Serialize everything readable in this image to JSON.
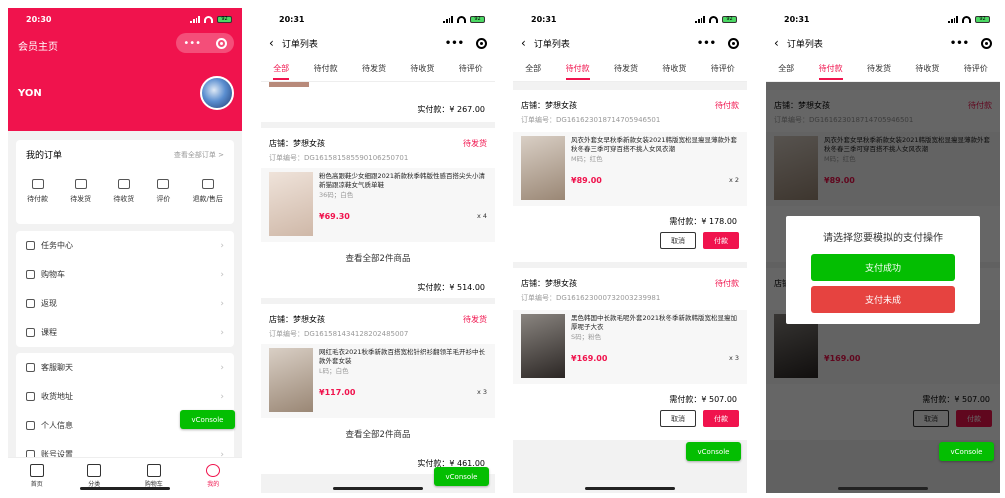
{
  "status": {
    "time1": "20:30",
    "time2": "20:31",
    "battery": "92"
  },
  "member": {
    "title": "会员主页",
    "capsule_dots": "•••",
    "username": "YON",
    "orders_title": "我的订单",
    "orders_more": "查看全部订单 >",
    "order_icons": [
      {
        "label": "待付款",
        "icon": "wallet-icon"
      },
      {
        "label": "待发货",
        "icon": "box-icon"
      },
      {
        "label": "待收货",
        "icon": "truck-icon"
      },
      {
        "label": "评价",
        "icon": "comment-icon"
      },
      {
        "label": "退款/售后",
        "icon": "refund-icon"
      }
    ],
    "menu1": [
      "任务中心",
      "购物车",
      "返现",
      "课程"
    ],
    "menu2": [
      "客服聊天",
      "收货地址",
      "个人信息",
      "账号设置"
    ],
    "tabbar": [
      "首页",
      "分类",
      "购物车",
      "我的"
    ],
    "vconsole": "vConsole"
  },
  "orders": {
    "nav_title": "订单列表",
    "back": "‹",
    "tabs": [
      "全部",
      "待付款",
      "待发货",
      "待收货",
      "待评价"
    ],
    "accent": "#f0134d",
    "all_list": {
      "prev_total": "实付款：¥ 267.00",
      "order1": {
        "shop": "店铺：梦想女孩",
        "status": "待发货",
        "no": "订单编号：DG161581585590106250701",
        "item": {
          "name": "粉色高跟鞋少女细跟2021新款秋季韩版性感百搭尖头小清新猫跟凉鞋女气质单鞋",
          "spec": "36码；白色",
          "price": "¥69.30",
          "qty": "x 4"
        },
        "view_all": "查看全部2件商品",
        "total": "实付款：¥ 514.00"
      },
      "order2": {
        "shop": "店铺：梦想女孩",
        "status": "待发货",
        "no": "订单编号：DG161581434128202485007",
        "item": {
          "name": "网红毛衣2021秋季新款百搭宽松针织衫翻领羊毛开衫中长款外套女装",
          "spec": "L码；白色",
          "price": "¥117.00",
          "qty": "x 3"
        },
        "view_all": "查看全部2件商品",
        "total": "实付款：¥ 461.00"
      }
    },
    "pending_list": {
      "order1": {
        "shop": "店铺：梦想女孩",
        "status": "待付款",
        "no": "订单编号：DG161623018714705946501",
        "item": {
          "name": "风衣外套女早秋季新款女装2021韩版宽松显瘦显薄款外套秋冬春三季可穿百搭不挑人女风衣潮",
          "spec": "M码；红色",
          "price": "¥89.00",
          "qty": "x 2"
        },
        "total": "需付款：¥ 178.00"
      },
      "order2": {
        "shop": "店铺：梦想女孩",
        "status": "待付款",
        "no": "订单编号：DG161623000732003239981",
        "item": {
          "name": "黑色韩国中长款毛呢外套2021秋冬季新款韩版宽松显瘦加厚呢子大衣",
          "spec": "S码；粉色",
          "price": "¥169.00",
          "qty": "x 3"
        },
        "total": "需付款：¥ 507.00"
      },
      "cancel": "取消",
      "pay": "付款"
    },
    "modal": {
      "title": "请选择您要模拟的支付操作",
      "ok": "支付成功",
      "fail": "支付未成"
    },
    "vconsole": "vConsole"
  }
}
